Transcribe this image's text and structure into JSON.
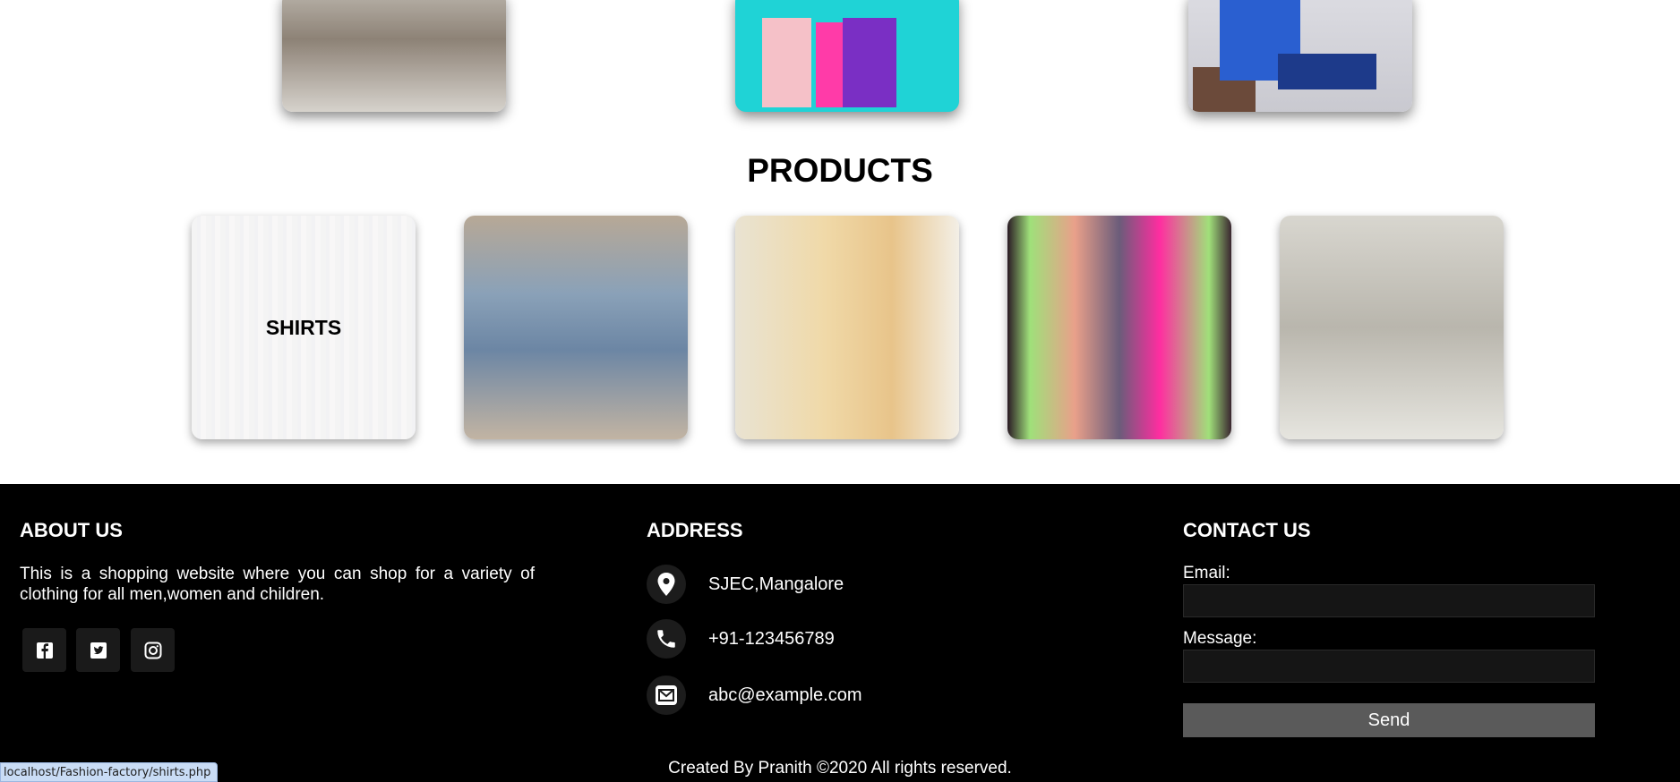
{
  "products": {
    "title": "PRODUCTS",
    "items": [
      {
        "label": "SHIRTS"
      },
      {
        "label": ""
      },
      {
        "label": ""
      },
      {
        "label": ""
      },
      {
        "label": ""
      }
    ]
  },
  "footer": {
    "about": {
      "heading": "ABOUT US",
      "text": "This is a shopping website where you can shop for a variety of clothing for all men,women and children."
    },
    "social": [
      "facebook-icon",
      "twitter-icon",
      "instagram-icon"
    ],
    "address": {
      "heading": "ADDRESS",
      "location": "SJEC,Mangalore",
      "phone": "+91-123456789",
      "email": "abc@example.com"
    },
    "contact": {
      "heading": "CONTACT US",
      "email_label": "Email:",
      "message_label": "Message:",
      "send_label": "Send"
    },
    "copyright": "Created By Pranith ©2020 All rights reserved."
  },
  "status_bar": {
    "url": "localhost/Fashion-factory/shirts.php"
  }
}
